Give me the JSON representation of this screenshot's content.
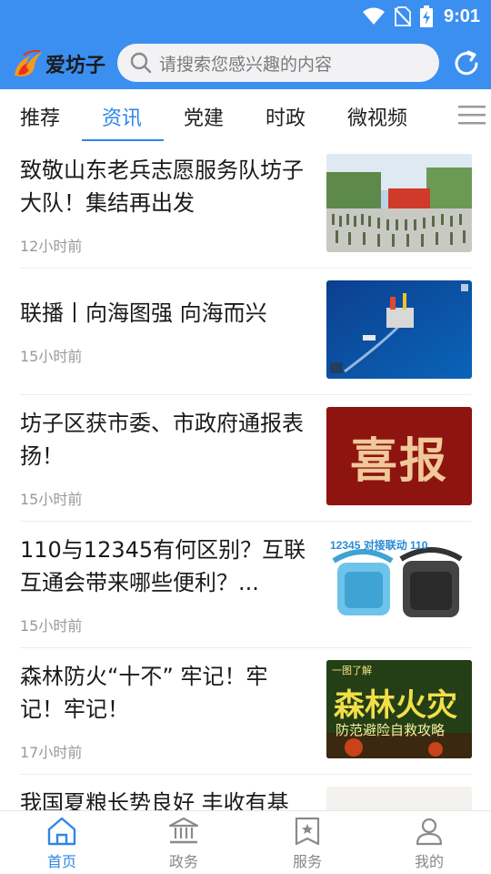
{
  "status_bar": {
    "time": "9:01"
  },
  "header": {
    "logo_text": "爱坊子",
    "search_placeholder": "请搜索您感兴趣的内容"
  },
  "tabs": [
    {
      "label": "推荐"
    },
    {
      "label": "资讯",
      "active": true
    },
    {
      "label": "党建"
    },
    {
      "label": "时政"
    },
    {
      "label": "微视频"
    }
  ],
  "articles": [
    {
      "title": "致敬山东老兵志愿服务队坊子大队！集结再出发",
      "time": "12小时前"
    },
    {
      "title": "联播丨向海图强 向海而兴",
      "time": "15小时前"
    },
    {
      "title": "坊子区获市委、市政府通报表扬！",
      "time": "15小时前",
      "thumb_text": "喜报"
    },
    {
      "title": "110与12345有何区别？互联互通会带来哪些便利？...",
      "time": "15小时前",
      "thumb_text": "12345 对接联动 110"
    },
    {
      "title": "森林防火“十不” 牢记！牢记！牢记！",
      "time": "17小时前",
      "thumb_text": "森林火灾",
      "thumb_sub": "防范避险自救攻略",
      "thumb_tag": "一图了解"
    },
    {
      "title": "我国夏粮长势良好 丰收有基"
    }
  ],
  "bottom_nav": [
    {
      "label": "首页",
      "icon": "home-icon",
      "active": true
    },
    {
      "label": "政务",
      "icon": "government-icon"
    },
    {
      "label": "服务",
      "icon": "service-icon"
    },
    {
      "label": "我的",
      "icon": "profile-icon"
    }
  ],
  "colors": {
    "primary": "#3b8ff0",
    "accent": "#2e86e8",
    "text": "#1a1a1a",
    "muted": "#9a9a9a"
  }
}
